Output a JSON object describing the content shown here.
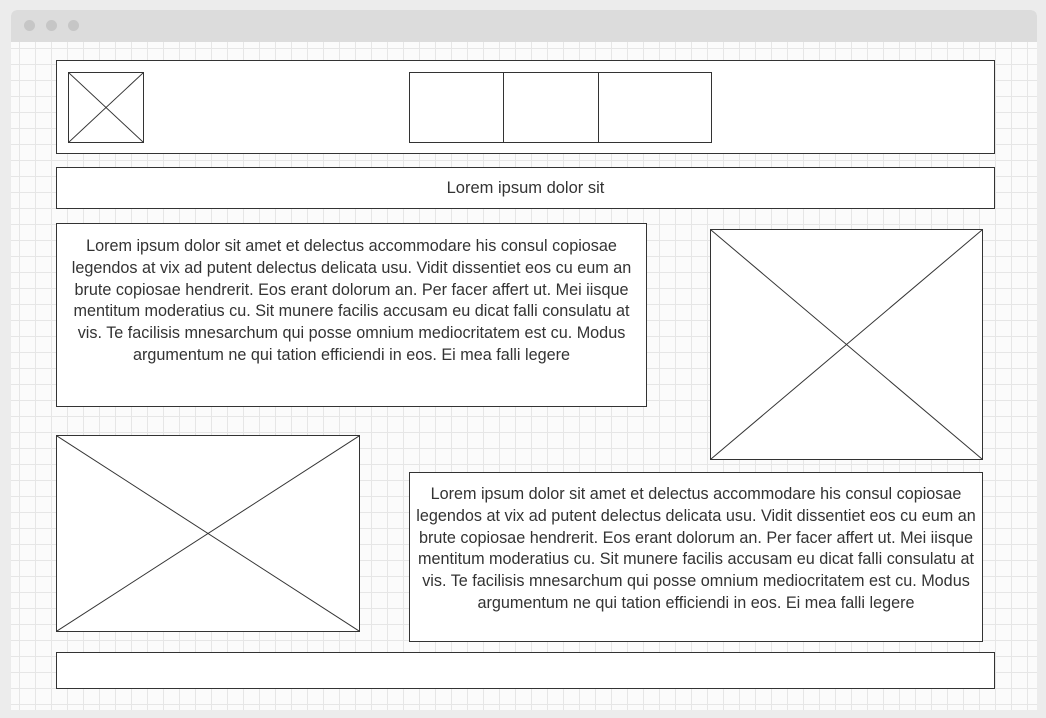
{
  "window": {
    "controls": [
      "close",
      "minimize",
      "maximize"
    ]
  },
  "header": {
    "logo_icon": "image-placeholder-icon",
    "nav_items": [
      "",
      "",
      ""
    ]
  },
  "title_bar": {
    "text": "Lorem ipsum dolor sit"
  },
  "section1": {
    "paragraph": "Lorem ipsum dolor sit amet et delectus accommodare his consul copiosae legendos at vix ad putent delectus delicata usu. Vidit dissentiet eos cu eum an brute copiosae hendrerit. Eos erant dolorum an. Per facer affert ut. Mei iisque mentitum moderatius cu. Sit munere facilis accusam eu dicat falli consulatu at vis. Te facilisis mnesarchum qui posse omnium mediocritatem est cu. Modus argumentum ne qui tation efficiendi in eos. Ei mea falli legere",
    "image_icon": "image-placeholder-icon"
  },
  "section2": {
    "image_icon": "image-placeholder-icon",
    "paragraph": "Lorem ipsum dolor sit amet et delectus accommodare his consul copiosae legendos at vix ad putent delectus delicata usu. Vidit dissentiet eos cu eum an brute copiosae hendrerit. Eos erant dolorum an. Per facer affert ut. Mei iisque mentitum moderatius cu. Sit munere facilis accusam eu dicat falli consulatu at vis. Te facilisis mnesarchum qui posse omnium mediocritatem est cu. Modus argumentum ne qui tation efficiendi in eos. Ei mea falli legere"
  },
  "footer": {
    "text": ""
  },
  "colors": {
    "stroke": "#333333",
    "grid": "#e6e6e6",
    "titlebar": "#dcdcdc",
    "window_dot": "#c6c6c6"
  }
}
